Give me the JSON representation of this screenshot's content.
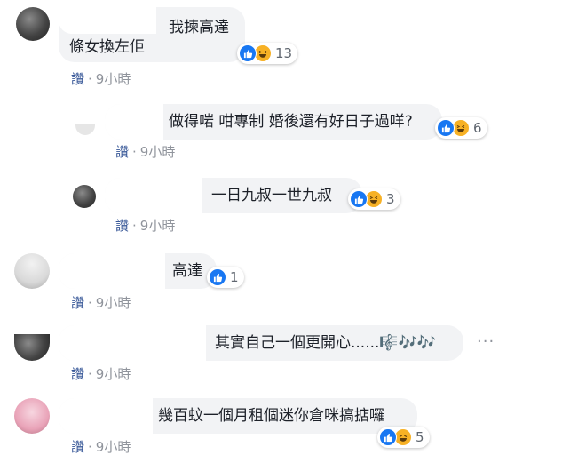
{
  "comments": [
    {
      "texts": [
        "我揀高達",
        "條女換左佢"
      ],
      "reactions": {
        "icons": [
          "like-icon",
          "haha-icon"
        ],
        "count": "13"
      },
      "action": "讚",
      "separator": "·",
      "time": "9小時"
    },
    {
      "texts": [
        "做得啱 咁專制 婚後還有好日子過咩?"
      ],
      "reactions": {
        "icons": [
          "like-icon",
          "haha-icon"
        ],
        "count": "6"
      },
      "action": "讚",
      "separator": "·",
      "time": "9小時"
    },
    {
      "texts": [
        "一日九叔一世九叔"
      ],
      "reactions": {
        "icons": [
          "like-icon",
          "haha-icon"
        ],
        "count": "3"
      },
      "action": "讚",
      "separator": "·",
      "time": "9小時"
    },
    {
      "texts": [
        "高達"
      ],
      "reactions": {
        "icons": [
          "like-icon"
        ],
        "count": "1"
      },
      "action": "讚",
      "separator": "·",
      "time": "9小時"
    },
    {
      "texts": [
        "其實自己一個更開心......🎼🎶🎶"
      ],
      "more_label": "···",
      "action": "讚",
      "separator": "·",
      "time": "9小時"
    },
    {
      "texts": [
        "幾百蚊一個月租個迷你倉咪搞掂囉"
      ],
      "reactions": {
        "icons": [
          "like-icon",
          "haha-icon"
        ],
        "count": "5"
      },
      "action": "讚",
      "separator": "·",
      "time": "9小時"
    }
  ],
  "colors": {
    "bubble": "#f2f3f5",
    "link": "#385898",
    "meta": "#90949c",
    "like": "#1877f2",
    "haha": "#f7b125"
  }
}
